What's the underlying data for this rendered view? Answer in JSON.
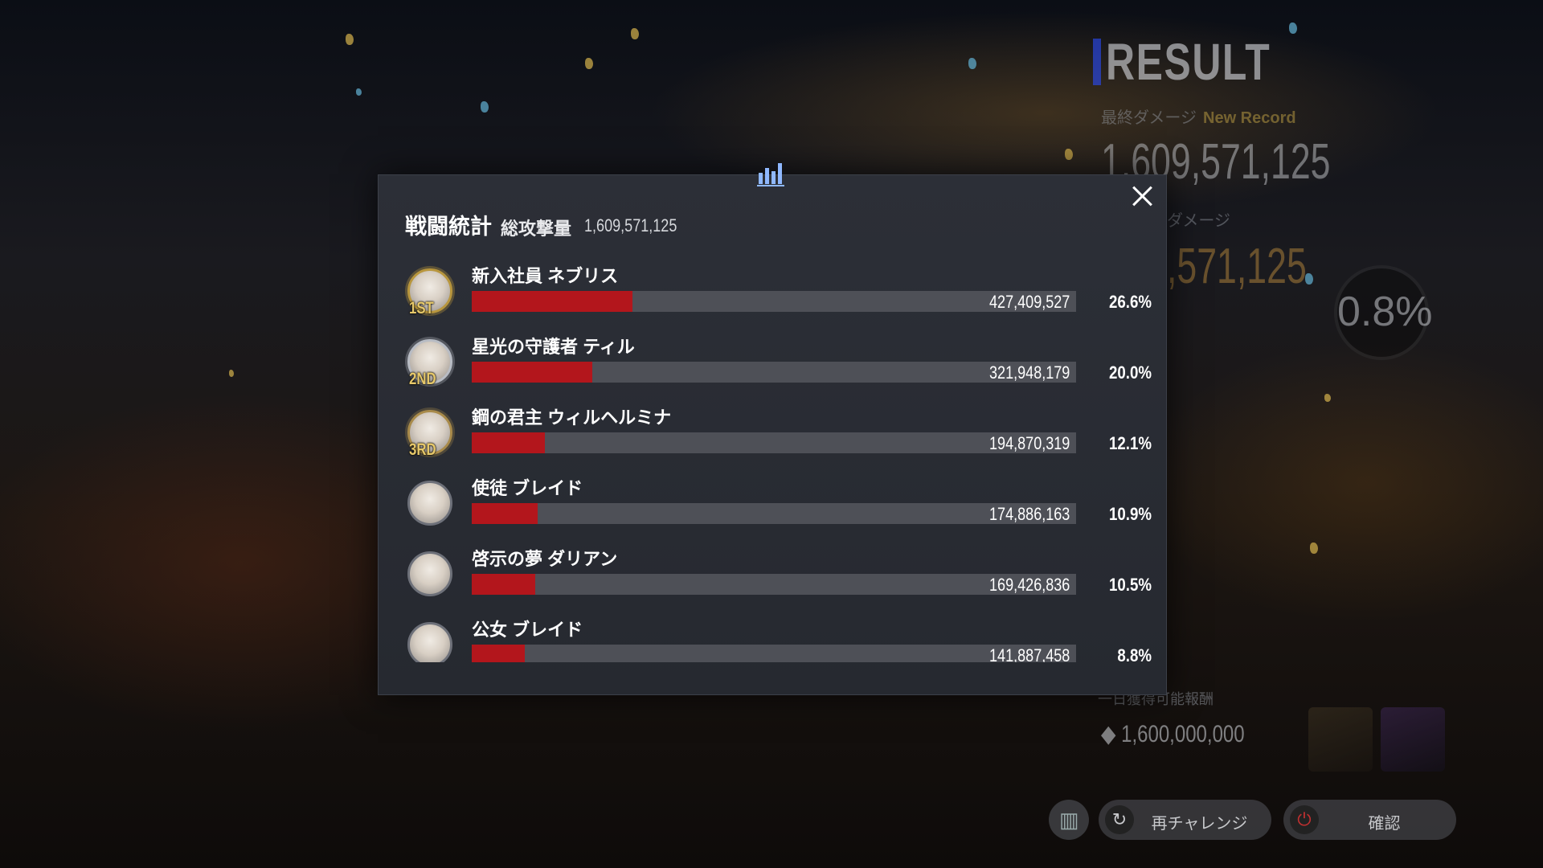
{
  "background": {
    "result_title": "RESULT",
    "final_damage_label": "最終ダメージ",
    "new_record_label": "New Record",
    "final_damage_value": "1,609,571,125",
    "damage_label_partial": "ダメージ",
    "damage_value_partial": ",571,125",
    "gauge_value": "0.8%",
    "reward_label": "一日獲得可能報酬",
    "reward_value": "1,600,000,000",
    "retry_button": "再チャレンジ",
    "confirm_button": "確認"
  },
  "modal": {
    "title": "戦闘統計",
    "subtitle": "総攻撃量",
    "total": "1,609,571,125",
    "rows": [
      {
        "rank": "1ST",
        "name": "新入社員 ネブリス",
        "value": "427,409,527",
        "percent_label": "26.6%",
        "percent": 26.6
      },
      {
        "rank": "2ND",
        "name": "星光の守護者 ティル",
        "value": "321,948,179",
        "percent_label": "20.0%",
        "percent": 20.0
      },
      {
        "rank": "3RD",
        "name": "鋼の君主 ウィルヘルミナ",
        "value": "194,870,319",
        "percent_label": "12.1%",
        "percent": 12.1
      },
      {
        "rank": "",
        "name": "使徒 ブレイド",
        "value": "174,886,163",
        "percent_label": "10.9%",
        "percent": 10.9
      },
      {
        "rank": "",
        "name": "啓示の夢 ダリアン",
        "value": "169,426,836",
        "percent_label": "10.5%",
        "percent": 10.5
      },
      {
        "rank": "",
        "name": "公女 ブレイド",
        "value": "141,887,458",
        "percent_label": "8.8%",
        "percent": 8.8
      }
    ]
  },
  "colors": {
    "bar_fill": "#b3161c",
    "bar_track": "#4e5057",
    "modal_bg": "#2a2d34",
    "rank_gold": "#e6c86a"
  }
}
